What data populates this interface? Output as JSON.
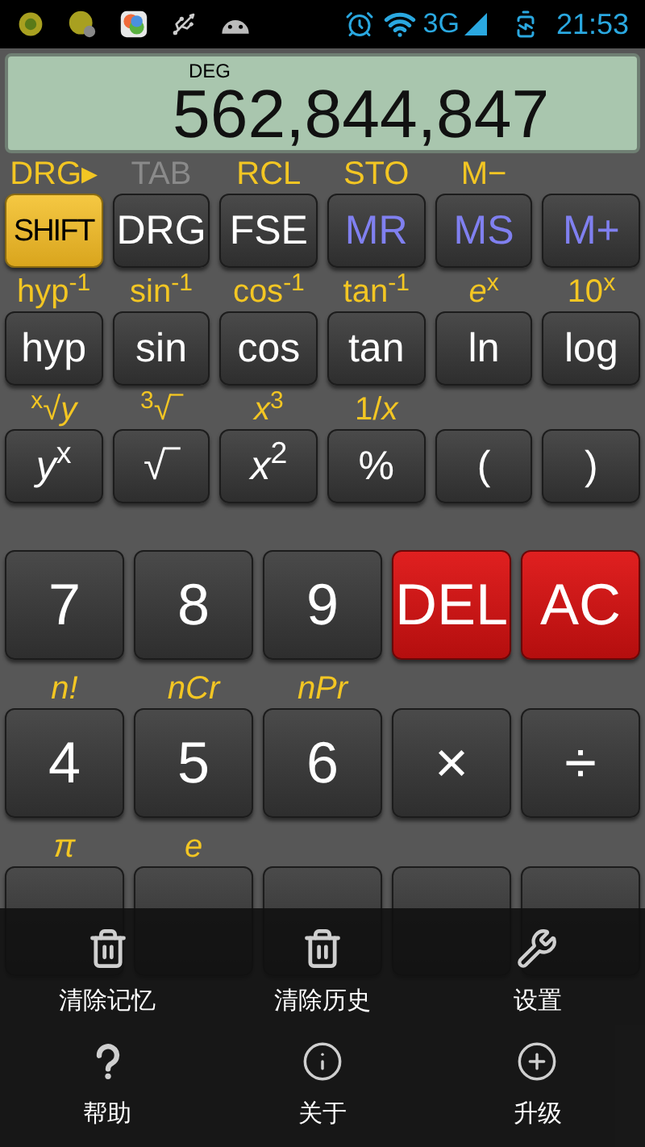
{
  "status_bar": {
    "network": "3G",
    "time": "21:53"
  },
  "display": {
    "mode": "DEG",
    "value": "562,844,847"
  },
  "sci_rows": [
    {
      "keys": [
        {
          "kind": "shift",
          "label": "SHIFT",
          "shift": {
            "text": "DRG▸",
            "disabled": false
          }
        },
        {
          "kind": "normal",
          "label": "DRG",
          "shift": {
            "text": "TAB",
            "disabled": true
          }
        },
        {
          "kind": "normal",
          "label": "FSE",
          "shift": {
            "text": "RCL",
            "disabled": false
          }
        },
        {
          "kind": "memory",
          "label": "MR",
          "shift": {
            "text": "STO",
            "disabled": false
          }
        },
        {
          "kind": "memory",
          "label": "MS",
          "shift": {
            "text": "M−",
            "disabled": false
          }
        },
        {
          "kind": "memory",
          "label": "M+"
        }
      ]
    },
    {
      "keys": [
        {
          "kind": "normal",
          "label": "hyp",
          "shift": {
            "text": "hyp$^{-1}$",
            "disabled": false
          }
        },
        {
          "kind": "normal",
          "label": "sin",
          "shift": {
            "text": "sin$^{-1}$",
            "disabled": false
          }
        },
        {
          "kind": "normal",
          "label": "cos",
          "shift": {
            "text": "cos$^{-1}$",
            "disabled": false
          }
        },
        {
          "kind": "normal",
          "label": "tan",
          "shift": {
            "text": "tan$^{-1}$",
            "disabled": false
          }
        },
        {
          "kind": "normal",
          "label": "ln",
          "shift": {
            "text": "*e*$^{x}$",
            "disabled": false
          }
        },
        {
          "kind": "normal",
          "label": "log",
          "shift": {
            "text": "10$^{x}$",
            "disabled": false
          }
        }
      ]
    },
    {
      "keys": [
        {
          "kind": "normal",
          "label": "*y*$^{x}$",
          "shift": {
            "text": "$^{x}$√*y*",
            "disabled": false
          }
        },
        {
          "kind": "normal",
          "label": "√‾",
          "shift": {
            "text": "$^{3}$√‾",
            "disabled": false
          }
        },
        {
          "kind": "normal",
          "label": "*x*$^{2}$",
          "shift": {
            "text": "*x*$^{3}$",
            "disabled": false
          }
        },
        {
          "kind": "normal",
          "label": "%",
          "shift": {
            "text": "1/*x*",
            "disabled": false
          }
        },
        {
          "kind": "normal",
          "label": "("
        },
        {
          "kind": "normal",
          "label": ")"
        }
      ]
    }
  ],
  "num_rows": [
    {
      "keys": [
        {
          "kind": "normal",
          "label": "7"
        },
        {
          "kind": "normal",
          "label": "8"
        },
        {
          "kind": "normal",
          "label": "9"
        },
        {
          "kind": "danger",
          "label": "DEL"
        },
        {
          "kind": "danger",
          "label": "AC"
        }
      ]
    },
    {
      "keys": [
        {
          "kind": "normal",
          "label": "4",
          "shift": {
            "text": "*n!*",
            "disabled": false
          }
        },
        {
          "kind": "normal",
          "label": "5",
          "shift": {
            "text": "*nCr*",
            "disabled": false
          }
        },
        {
          "kind": "normal",
          "label": "6",
          "shift": {
            "text": "*nPr*",
            "disabled": false
          }
        },
        {
          "kind": "normal",
          "label": "×"
        },
        {
          "kind": "normal",
          "label": "÷"
        }
      ]
    },
    {
      "keys": [
        {
          "kind": "normal",
          "shift": {
            "text": "*π*",
            "disabled": false
          }
        },
        {
          "kind": "normal",
          "shift": {
            "text": "*e*",
            "disabled": false
          }
        },
        {
          "kind": "normal"
        },
        {
          "kind": "normal"
        },
        {
          "kind": "normal"
        }
      ]
    }
  ],
  "menu": {
    "items": [
      {
        "kind": "trash",
        "label": "清除记忆"
      },
      {
        "kind": "trash",
        "label": "清除历史"
      },
      {
        "kind": "wrench",
        "label": "设置"
      },
      {
        "kind": "help",
        "label": "帮助"
      },
      {
        "kind": "info",
        "label": "关于"
      },
      {
        "kind": "plus",
        "label": "升级"
      }
    ]
  }
}
